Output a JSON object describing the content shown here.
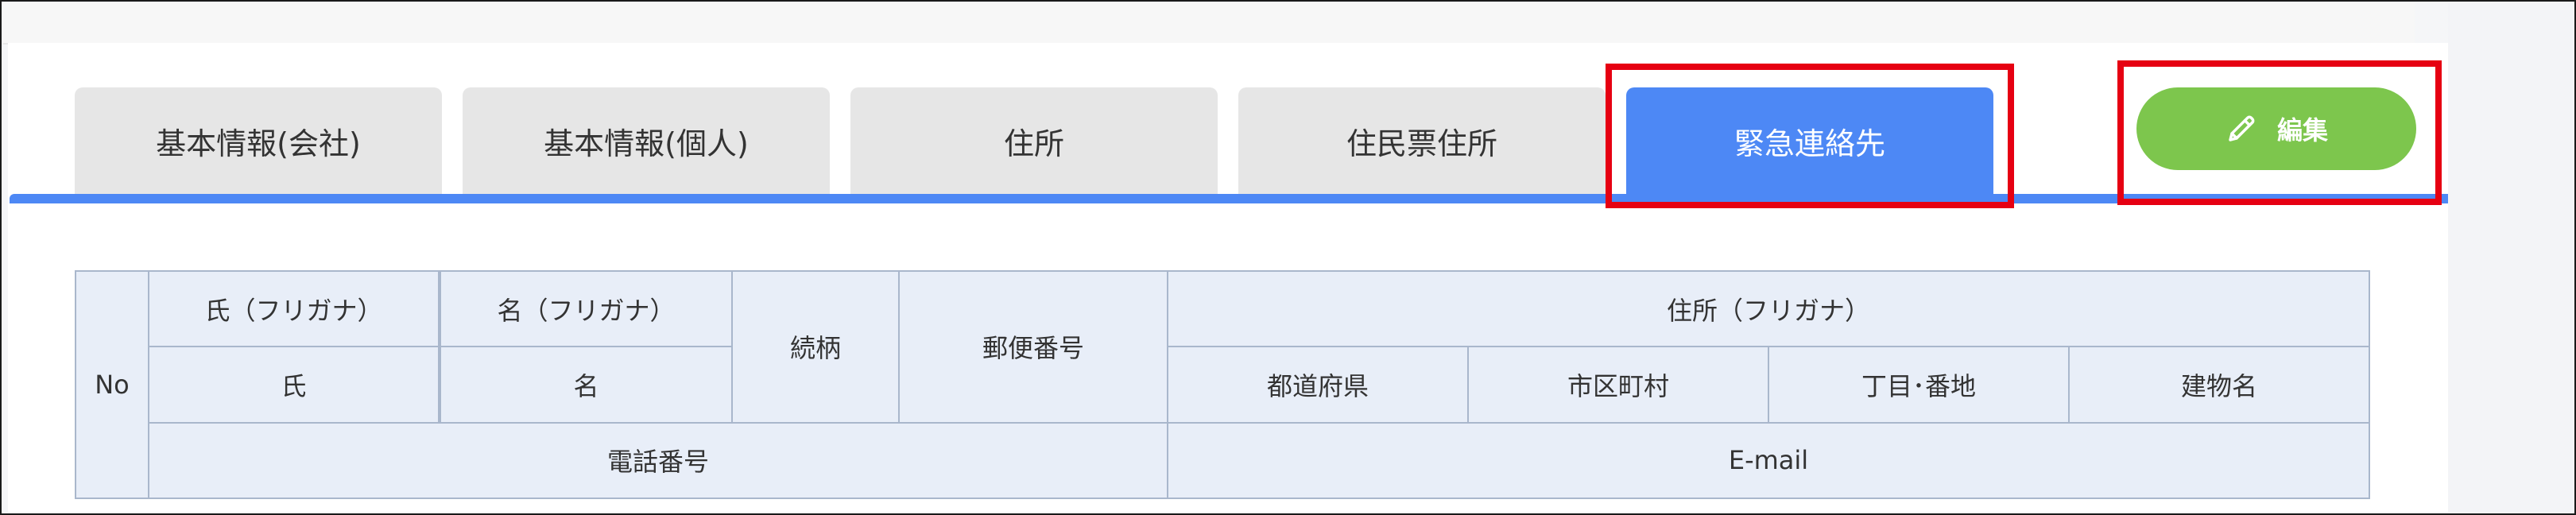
{
  "tabs": [
    {
      "label": "基本情報(会社)",
      "active": false
    },
    {
      "label": "基本情報(個人)",
      "active": false
    },
    {
      "label": "住所",
      "active": false
    },
    {
      "label": "住民票住所",
      "active": false
    },
    {
      "label": "緊急連絡先",
      "active": true
    }
  ],
  "toolbar": {
    "edit_label": "編集",
    "edit_icon": "pencil-icon"
  },
  "colors": {
    "tab_active": "#4d88f5",
    "tab_inactive": "#e6e6e6",
    "edit_button": "#7dc64d",
    "highlight": "#e60012",
    "table_header_bg": "#e8eef8",
    "table_border": "#a9b7cc"
  },
  "table": {
    "no": "No",
    "last_name_kana": "氏（フリガナ）",
    "first_name_kana": "名（フリガナ）",
    "last_name": "氏",
    "first_name": "名",
    "relationship": "続柄",
    "postal_code": "郵便番号",
    "address_kana": "住所（フリガナ）",
    "prefecture": "都道府県",
    "city": "市区町村",
    "block": "丁目･番地",
    "building": "建物名",
    "phone": "電話番号",
    "email": "E-mail"
  }
}
